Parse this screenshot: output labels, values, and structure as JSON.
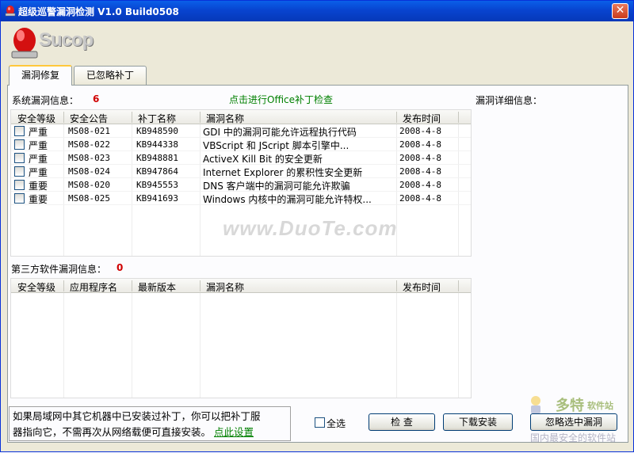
{
  "window": {
    "title": "超级巡警漏洞检测 V1.0 Build0508",
    "close_symbol": "✕"
  },
  "logo": {
    "text": "Sucop"
  },
  "tabs": [
    {
      "label": "漏洞修复"
    },
    {
      "label": "已忽略补丁"
    }
  ],
  "system": {
    "label": "系统漏洞信息：",
    "count": "6",
    "office_link": "点击进行Office补丁检查",
    "detail_label": "漏洞详细信息：",
    "columns": [
      "安全等级",
      "安全公告",
      "补丁名称",
      "漏洞名称",
      "发布时间"
    ],
    "rows": [
      {
        "level": "严重",
        "bulletin": "MS08-021",
        "patch": "KB948590",
        "name": "GDI 中的漏洞可能允许远程执行代码",
        "date": "2008-4-8"
      },
      {
        "level": "严重",
        "bulletin": "MS08-022",
        "patch": "KB944338",
        "name": "VBScript 和 JScript 脚本引擎中...",
        "date": "2008-4-8"
      },
      {
        "level": "严重",
        "bulletin": "MS08-023",
        "patch": "KB948881",
        "name": "ActiveX Kill Bit 的安全更新",
        "date": "2008-4-8"
      },
      {
        "level": "严重",
        "bulletin": "MS08-024",
        "patch": "KB947864",
        "name": "Internet Explorer 的累积性安全更新",
        "date": "2008-4-8"
      },
      {
        "level": "重要",
        "bulletin": "MS08-020",
        "patch": "KB945553",
        "name": "DNS 客户端中的漏洞可能允许欺骗",
        "date": "2008-4-8"
      },
      {
        "level": "重要",
        "bulletin": "MS08-025",
        "patch": "KB941693",
        "name": "Windows 内核中的漏洞可能允许特权...",
        "date": "2008-4-8"
      }
    ]
  },
  "third_party": {
    "label": "第三方软件漏洞信息：",
    "count": "0",
    "columns": [
      "安全等级",
      "应用程序名",
      "最新版本",
      "漏洞名称",
      "发布时间"
    ]
  },
  "watermark": "www.DuoTe.com",
  "footer": {
    "info_line1": "如果局域网中其它机器中已安装过补丁，你可以把补丁服",
    "info_line2": "器指向它，不需再次从网络载便可直接安装。",
    "settings_link": "点此设置",
    "select_all": "全选",
    "check_button": "检 查",
    "download_button": "下载安装",
    "ignore_button": "忽略选中漏洞"
  },
  "corner_brand": {
    "line1": "多特",
    "line2": "软件站",
    "line3": "国内最安全的软件站"
  },
  "colors": {
    "titlebar": "#0844d0",
    "severity_count": "#d00000",
    "link": "#008000"
  }
}
